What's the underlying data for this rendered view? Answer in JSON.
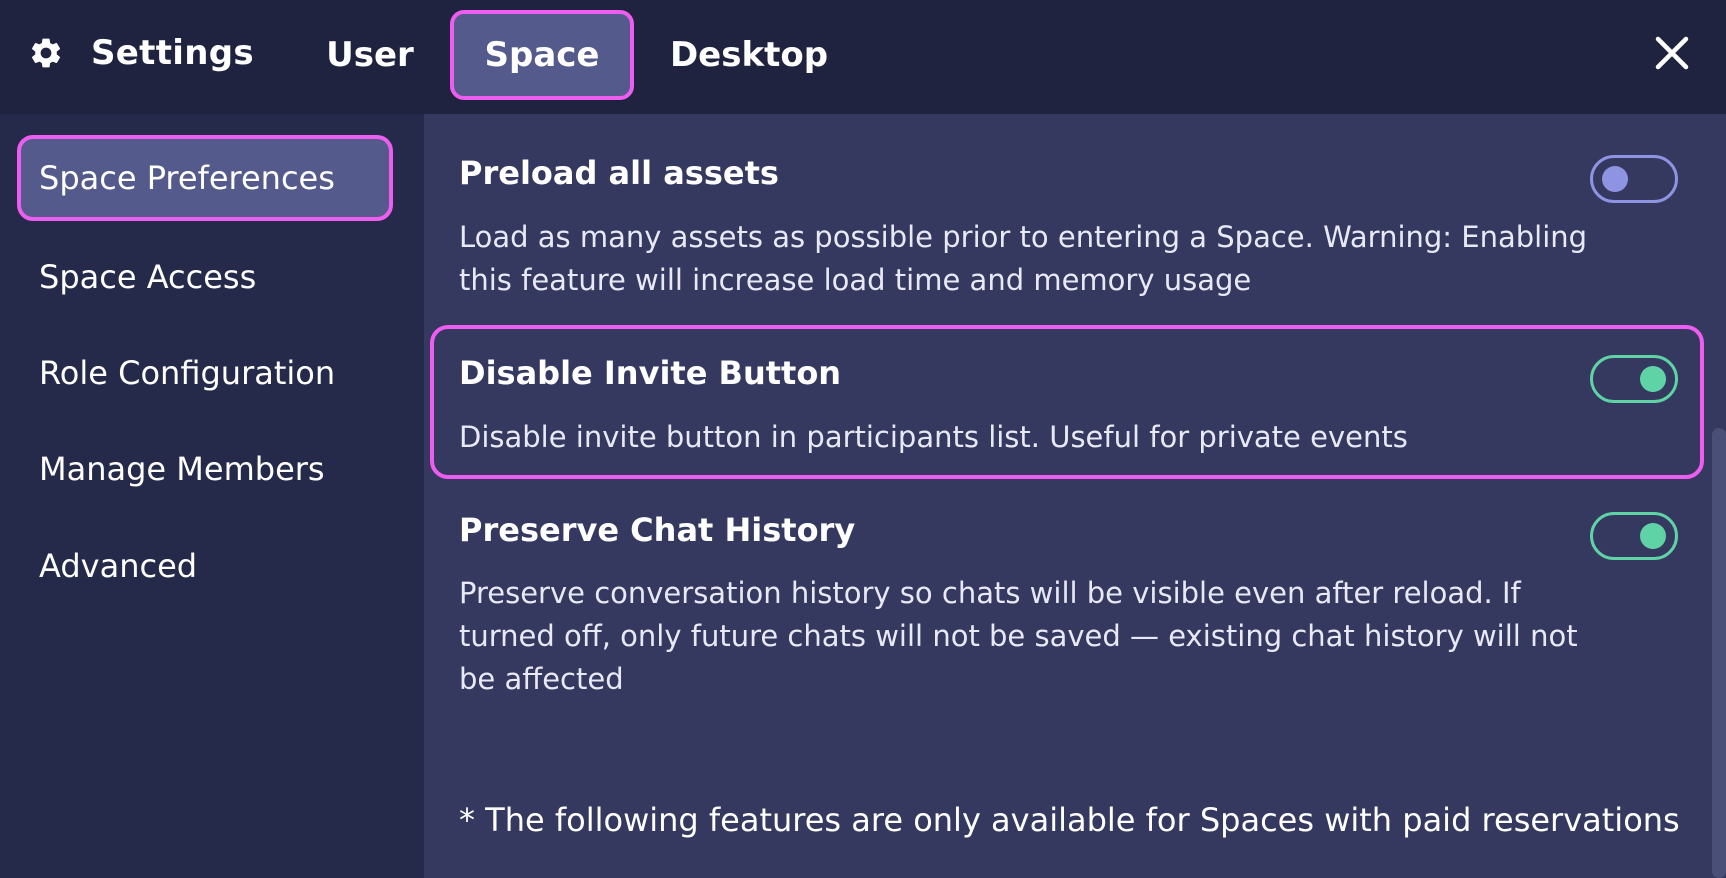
{
  "header": {
    "title": "Settings",
    "tabs": [
      {
        "label": "User",
        "active": false
      },
      {
        "label": "Space",
        "active": true
      },
      {
        "label": "Desktop",
        "active": false
      }
    ],
    "icons": {
      "settings": "gear-icon",
      "close": "close-icon"
    }
  },
  "sidebar": {
    "items": [
      {
        "label": "Space Preferences",
        "active": true
      },
      {
        "label": "Space Access",
        "active": false
      },
      {
        "label": "Role Configuration",
        "active": false
      },
      {
        "label": "Manage Members",
        "active": false
      },
      {
        "label": "Advanced",
        "active": false
      }
    ]
  },
  "settings": [
    {
      "title": "Preload all assets",
      "description": "Load as many assets as possible prior to entering a Space. Warning: Enabling this feature will increase load time and memory usage",
      "enabled": false
    },
    {
      "title": "Disable Invite Button",
      "description": "Disable invite button in participants list. Useful for private events",
      "enabled": true
    },
    {
      "title": "Preserve Chat History",
      "description": "Preserve conversation history so chats will be visible even after reload. If turned off, only future chats will not be saved — existing chat history will not be affected",
      "enabled": true
    }
  ],
  "footnote": "* The following features are only available for Spaces with paid reservations",
  "colors": {
    "highlight": "#ec5df0",
    "toggle_on": "#5fd3a5",
    "toggle_off": "#8e93e2",
    "header_bg": "#20233f",
    "main_bg": "#353960"
  }
}
